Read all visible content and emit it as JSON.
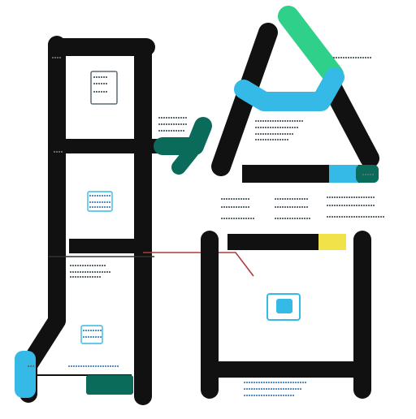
{
  "image": {
    "background": "#ffffff",
    "description_colors": {
      "stroke": "#111111",
      "accent_cyan": "#35b9e6",
      "accent_green": "#2fd08a",
      "accent_teal": "#0b6b5b",
      "accent_yellow": "#f2e24a",
      "accent_red": "#b23a3a",
      "label_gray": "#5e6b70",
      "label_blue": "#5a8fc6"
    }
  },
  "labels": {
    "top_right_text": "",
    "left_marker": "",
    "side_marker": ""
  }
}
